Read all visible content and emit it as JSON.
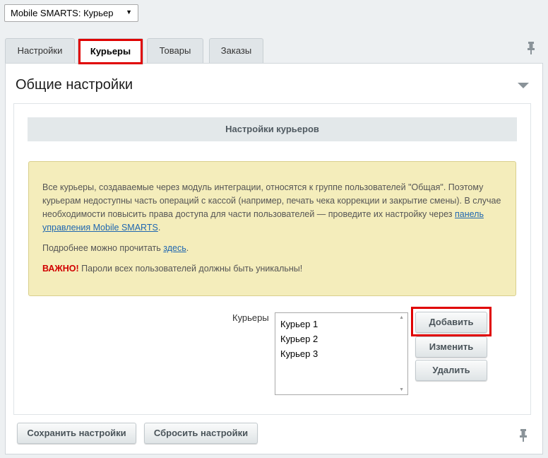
{
  "module_select": {
    "value": "Mobile SMARTS: Курьер"
  },
  "tabs": [
    {
      "label": "Настройки",
      "active": false
    },
    {
      "label": "Курьеры",
      "active": true
    },
    {
      "label": "Товары",
      "active": false
    },
    {
      "label": "Заказы",
      "active": false
    }
  ],
  "panel": {
    "title": "Общие настройки"
  },
  "section": {
    "title": "Настройки курьеров"
  },
  "notice": {
    "paragraph1_text": "Все курьеры, создаваемые через модуль интеграции, относятся к группе пользователей \"Общая\". Поэтому курьерам недоступны часть операций с кассой (например, печать чека коррекции и закрытие смены). В случае необходимости повысить права доступа для части пользователей — проведите их настройку через",
    "paragraph1_link": "панель управления Mobile SMARTS",
    "paragraph1_end": ".",
    "paragraph2_text": "Подробнее можно прочитать",
    "paragraph2_link": "здесь",
    "paragraph2_end": ".",
    "important_label": "ВАЖНО!",
    "important_text": "Пароли всех пользователей должны быть уникальны!"
  },
  "couriers": {
    "label": "Курьеры",
    "items": [
      "Курьер 1",
      "Курьер 2",
      "Курьер 3"
    ],
    "add_label": "Добавить",
    "edit_label": "Изменить",
    "delete_label": "Удалить"
  },
  "footer": {
    "save_label": "Сохранить настройки",
    "reset_label": "Сбросить настройки"
  },
  "colors": {
    "highlight": "#e00000",
    "notice_bg": "#f4edbb",
    "link": "#2067b0",
    "important": "#d10000"
  },
  "icons": {
    "pin": "pin-icon",
    "collapse": "collapse-triangle-icon"
  }
}
